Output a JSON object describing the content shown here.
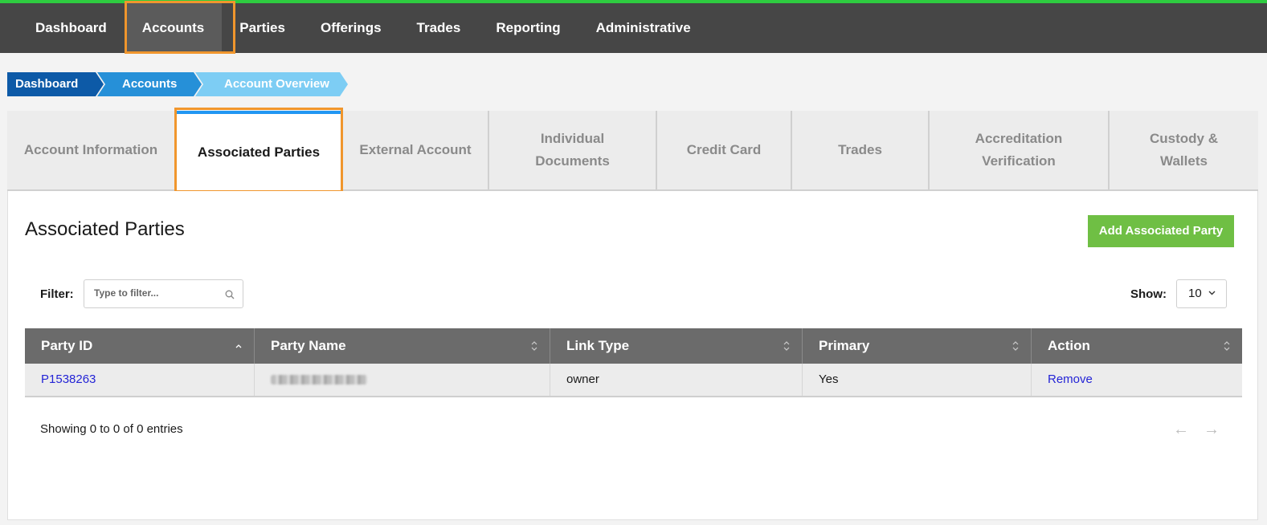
{
  "nav": {
    "items": [
      {
        "label": "Dashboard"
      },
      {
        "label": "Accounts"
      },
      {
        "label": "Parties"
      },
      {
        "label": "Offerings"
      },
      {
        "label": "Trades"
      },
      {
        "label": "Reporting"
      },
      {
        "label": "Administrative"
      }
    ],
    "active": "Accounts"
  },
  "breadcrumb": {
    "items": [
      {
        "label": "Dashboard",
        "color": "#0d5aa7"
      },
      {
        "label": "Accounts",
        "color": "#2690d8"
      },
      {
        "label": "Account Overview",
        "color": "#7dcdf4"
      }
    ]
  },
  "tabs": {
    "items": [
      {
        "label": "Account Information"
      },
      {
        "label": "Associated Parties"
      },
      {
        "label": "External Account"
      },
      {
        "label": "Individual Documents"
      },
      {
        "label": "Credit Card"
      },
      {
        "label": "Trades"
      },
      {
        "label": "Accreditation Verification"
      },
      {
        "label": "Custody & Wallets"
      }
    ],
    "active": "Associated Parties"
  },
  "panel": {
    "title": "Associated Parties",
    "add_button_label": "Add Associated Party"
  },
  "filter": {
    "label": "Filter:",
    "placeholder": "Type to filter..."
  },
  "show": {
    "label": "Show:",
    "value": "10"
  },
  "table": {
    "columns": [
      "Party ID",
      "Party Name",
      "Link Type",
      "Primary",
      "Action"
    ],
    "rows": [
      {
        "party_id": "P1538263",
        "party_name": "",
        "link_type": "owner",
        "primary": "Yes",
        "action": "Remove"
      }
    ]
  },
  "footer": {
    "showing_text": "Showing 0 to 0 of 0 entries",
    "prev_arrow": "←",
    "next_arrow": "→"
  },
  "colors": {
    "accent_green": "#6fbf44",
    "highlight_orange": "#f0962d",
    "tab_active_blue": "#2196f3",
    "link_blue": "#2424d6"
  }
}
